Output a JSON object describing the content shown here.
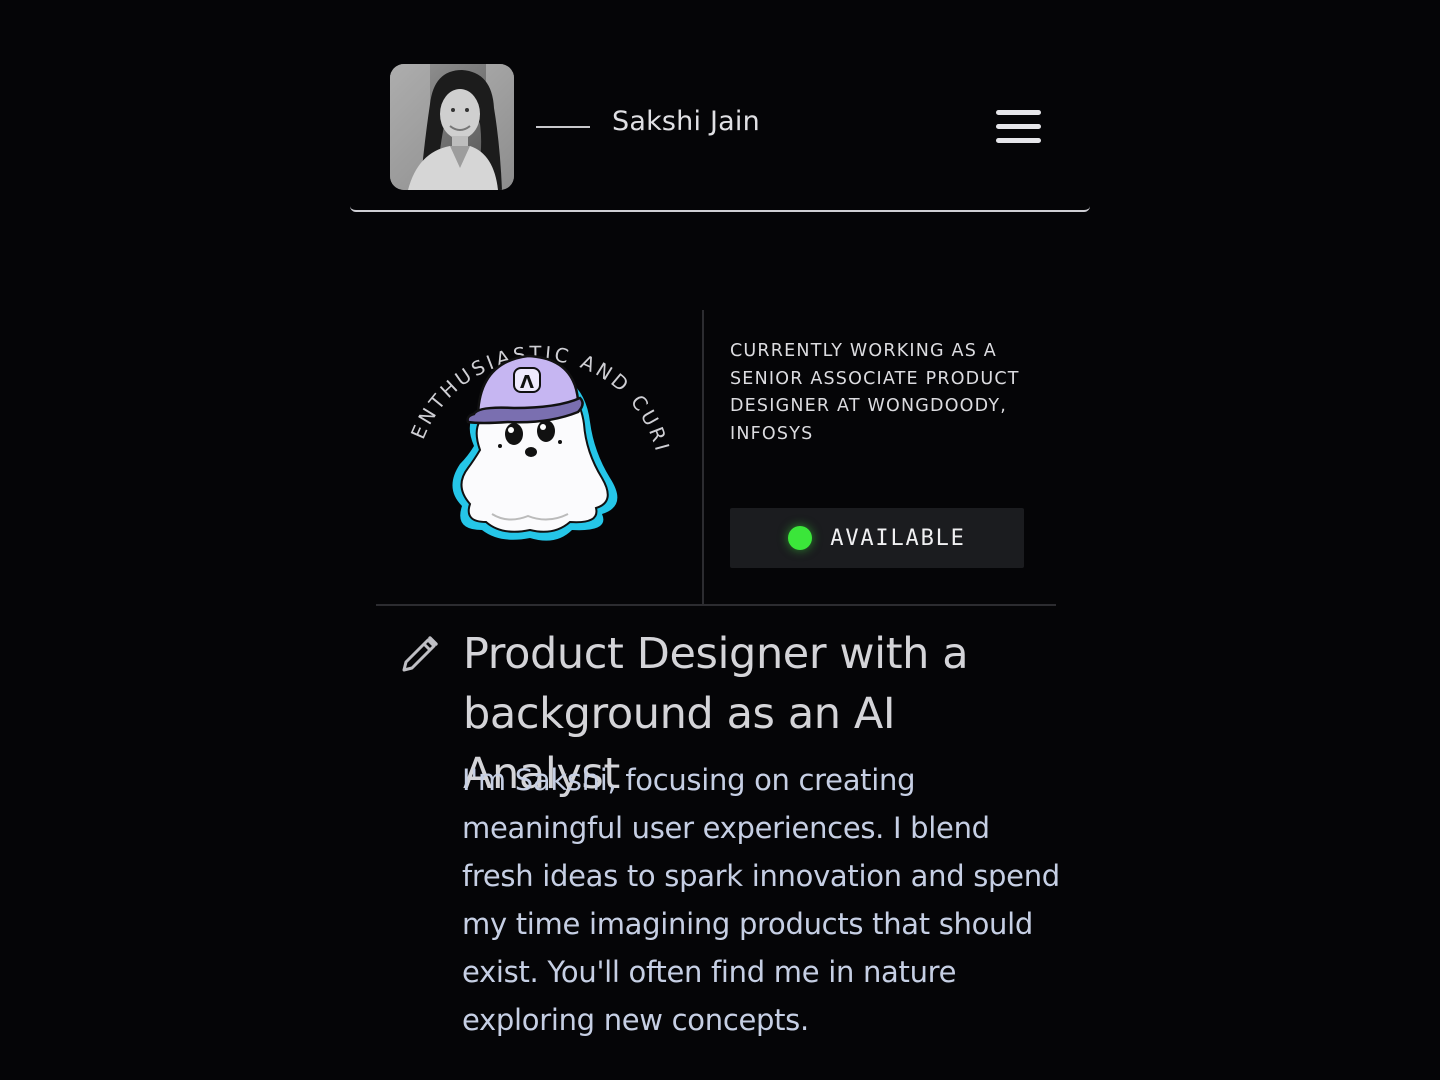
{
  "header": {
    "name": "Sakshi Jain",
    "menu_icon": "hamburger-menu-icon"
  },
  "hero": {
    "badge_text": "ENTHUSIASTIC AND CURIOUS",
    "badge_logo_letter": "Λ",
    "current_role": "CURRENTLY WORKING AS A SENIOR ASSOCIATE PRODUCT DESIGNER AT WONGDOODY, INFOSYS",
    "status": {
      "label": "AVAILABLE",
      "color": "#3be63a"
    }
  },
  "intro": {
    "icon": "pencil-icon",
    "headline": "Product Designer with a background as an AI Analyst",
    "bio": "I'm Sakshi, focusing on creating meaningful user experiences. I blend fresh ideas to spark innovation and spend my time imagining products that should exist. You'll often find me in nature exploring new concepts."
  },
  "colors": {
    "background": "#050507",
    "accent_cyan": "#25c6e8",
    "cap_purple": "#c6b6f2",
    "status_green": "#3be63a"
  }
}
